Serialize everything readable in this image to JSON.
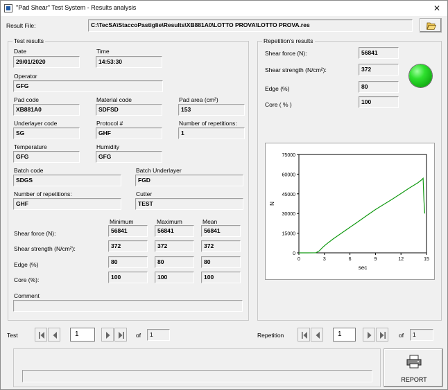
{
  "window": {
    "title": "\"Pad Shear\" Test System - Results analysis",
    "close": "✕"
  },
  "result_file": {
    "label": "Result File:",
    "value": "C:\\TecSA\\StaccoPastiglie\\Results\\XB881A0\\LOTTO PROVA\\LOTTO PROVA.res",
    "browse_icon": "folder-open-icon"
  },
  "test_results": {
    "title": "Test results",
    "date": {
      "label": "Date",
      "value": "29/01/2020"
    },
    "time": {
      "label": "Time",
      "value": "14:53:30"
    },
    "operator": {
      "label": "Operator",
      "value": "GFG"
    },
    "pad_code": {
      "label": "Pad code",
      "value": "XB881A0"
    },
    "material_code": {
      "label": "Material code",
      "value": "SDFSD"
    },
    "pad_area": {
      "label": "Pad area (cm²)",
      "value": "153"
    },
    "underlayer_code": {
      "label": "Underlayer code",
      "value": "SG"
    },
    "protocol": {
      "label": "Protocol #",
      "value": "GHF"
    },
    "num_repetitions_top": {
      "label": "Number of repetitions:",
      "value": "1"
    },
    "temperature": {
      "label": "Temperature",
      "value": "GFG"
    },
    "humidity": {
      "label": "Humidity",
      "value": "GFG"
    },
    "batch_code": {
      "label": "Batch code",
      "value": "SDGS"
    },
    "batch_underlayer": {
      "label": "Batch Underlayer",
      "value": "FGD"
    },
    "num_repetitions": {
      "label": "Number of repetitions:",
      "value": "GHF"
    },
    "cutter": {
      "label": "Cutter",
      "value": "TEST"
    },
    "stats": {
      "headers": [
        "Minimum",
        "Maximum",
        "Mean"
      ],
      "rows": [
        {
          "label": "Shear force (N):",
          "values": [
            "56841",
            "56841",
            "56841"
          ]
        },
        {
          "label": "Shear strength (N/cm²):",
          "values": [
            "372",
            "372",
            "372"
          ]
        },
        {
          "label": "Edge (%)",
          "values": [
            "80",
            "80",
            "80"
          ]
        },
        {
          "label": "Core (%):",
          "values": [
            "100",
            "100",
            "100"
          ]
        }
      ]
    },
    "comment": {
      "label": "Comment",
      "value": ""
    }
  },
  "repetition_results": {
    "title": "Repetition's results",
    "shear_force": {
      "label": "Shear force (N):",
      "value": "56841"
    },
    "shear_strength": {
      "label": "Shear strength (N/cm²):",
      "value": "372"
    },
    "edge": {
      "label": "Edge (%)",
      "value": "80"
    },
    "core": {
      "label": "Core ( % )",
      "value": "100"
    },
    "status_color": "#22cc22"
  },
  "chart_data": {
    "type": "line",
    "xlabel": "sec",
    "ylabel": "N",
    "xlim": [
      0,
      15
    ],
    "ylim": [
      0,
      75000
    ],
    "xticks": [
      "0",
      "3",
      "6",
      "9",
      "12",
      "15"
    ],
    "yticks": [
      "0",
      "15000",
      "30000",
      "45000",
      "60000",
      "75000"
    ],
    "series": [
      {
        "color": "#119911",
        "x": [
          0,
          1.0,
          2.0,
          2.4,
          2.8,
          3.2,
          4,
          5,
          6,
          7,
          8,
          9,
          10,
          11,
          12,
          13,
          14,
          14.4,
          14.6,
          14.7,
          14.8
        ],
        "y": [
          0,
          0,
          50,
          1500,
          4200,
          6500,
          10500,
          15000,
          19500,
          24000,
          28500,
          33000,
          37000,
          41000,
          45200,
          49500,
          53500,
          55500,
          56841,
          40000,
          30000
        ]
      }
    ]
  },
  "navigation": {
    "test_label": "Test",
    "test_value": "1",
    "test_of": "of",
    "test_total": "1",
    "repetition_label": "Repetition",
    "repetition_value": "1",
    "repetition_of": "of",
    "repetition_total": "1"
  },
  "report": {
    "label": "REPORT",
    "icon": "printer-icon"
  }
}
